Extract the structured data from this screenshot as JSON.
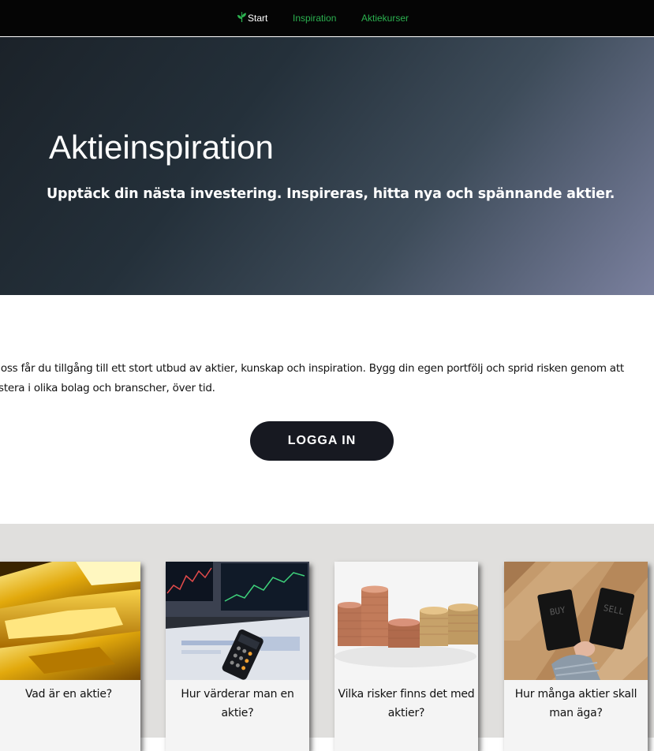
{
  "nav": {
    "items": [
      {
        "label": "Start",
        "active": true,
        "icon": "leaf-icon"
      },
      {
        "label": "Inspiration",
        "active": false
      },
      {
        "label": "Aktiekurser",
        "active": false
      }
    ]
  },
  "hero": {
    "title": "Aktieinspiration",
    "subtitle": "Upptäck din nästa investering. Inspireras, hitta nya och spännande aktier."
  },
  "intro": {
    "text": "s oss får du tillgång till ett stort utbud av aktier, kunskap och inspiration. Bygg din egen portfölj och sprid risken genom att estera i olika bolag och branscher, över tid.",
    "login_label": "LOGGA IN"
  },
  "cards": [
    {
      "label": "Vad är en aktie?",
      "image": "gold-bars"
    },
    {
      "label": "Hur värderar man en aktie?",
      "image": "trading-screens-calculator"
    },
    {
      "label": "Vilka risker finns det med aktier?",
      "image": "coin-stacks"
    },
    {
      "label": "Hur många aktier skall man äga?",
      "image": "buy-sell-cards",
      "image_text": [
        "BUY",
        "SELL"
      ]
    }
  ],
  "colors": {
    "nav_bg": "#050505",
    "nav_link": "#2bb04f",
    "button_bg": "#171921",
    "cards_bg": "#e0dfdd"
  }
}
